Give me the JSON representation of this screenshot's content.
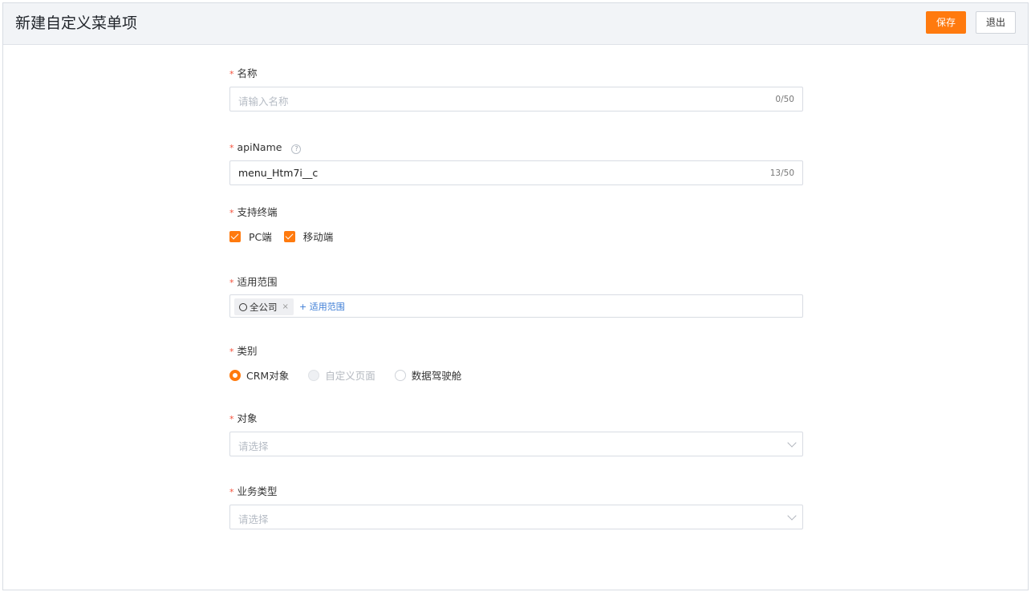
{
  "header": {
    "title": "新建自定义菜单项",
    "save_label": "保存",
    "exit_label": "退出"
  },
  "form": {
    "name": {
      "required_mark": "*",
      "label": "名称",
      "placeholder": "请输入名称",
      "count": "0/50"
    },
    "api_name": {
      "required_mark": "*",
      "label": "apiName",
      "help": "?",
      "value": "menu_Htm7i__c",
      "count": "13/50"
    },
    "terminals": {
      "required_mark": "*",
      "label": "支持终端",
      "options": [
        {
          "label": "PC端",
          "checked": true
        },
        {
          "label": "移动端",
          "checked": true
        }
      ]
    },
    "scope": {
      "required_mark": "*",
      "label": "适用范围",
      "tag": "全公司",
      "tag_remove": "×",
      "add_label": "+ 适用范围"
    },
    "category": {
      "required_mark": "*",
      "label": "类别",
      "options": [
        {
          "label": "CRM对象",
          "selected": true,
          "disabled": false
        },
        {
          "label": "自定义页面",
          "selected": false,
          "disabled": true
        },
        {
          "label": "数据驾驶舱",
          "selected": false,
          "disabled": false
        }
      ]
    },
    "object": {
      "required_mark": "*",
      "label": "对象",
      "placeholder": "请选择"
    },
    "business_type": {
      "required_mark": "*",
      "label": "业务类型",
      "placeholder": "请选择"
    }
  },
  "colors": {
    "accent": "#ff7a0e",
    "link": "#3a7bd5",
    "required": "#f5513b"
  }
}
